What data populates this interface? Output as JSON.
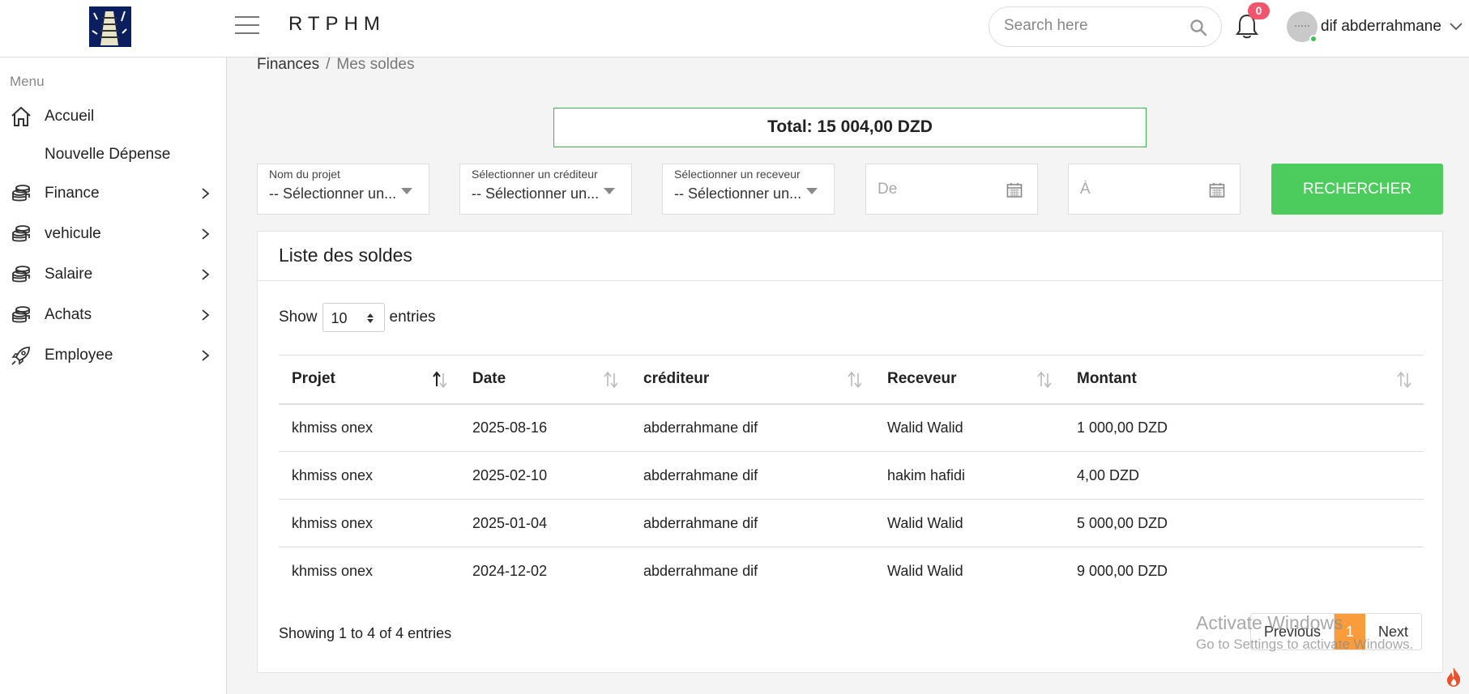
{
  "header": {
    "brand": "RTPHM",
    "search_placeholder": "Search here",
    "notification_count": "0",
    "user_name": "dif abderrahmane"
  },
  "sidebar": {
    "heading": "Menu",
    "items": [
      {
        "label": "Accueil",
        "icon": "home-icon"
      },
      {
        "label": "Nouvelle Dépense",
        "icon": ""
      },
      {
        "label": "Finance",
        "icon": "coins-icon"
      },
      {
        "label": "vehicule",
        "icon": "coins-icon"
      },
      {
        "label": "Salaire",
        "icon": "coins-icon"
      },
      {
        "label": "Achats",
        "icon": "coins-icon"
      },
      {
        "label": "Employee",
        "icon": "rocket-icon"
      }
    ]
  },
  "breadcrumb": {
    "parent": "Finances",
    "separator": "/",
    "current": "Mes soldes"
  },
  "total": "Total: 15 004,00 DZD",
  "filters": {
    "project": {
      "label": "Nom du projet",
      "value": "-- Sélectionner un..."
    },
    "creditor": {
      "label": "Sélectionner un créditeur",
      "value": "-- Sélectionner un..."
    },
    "receiver": {
      "label": "Sélectionner un receveur",
      "value": "-- Sélectionner un..."
    },
    "from_placeholder": "De",
    "to_placeholder": "À",
    "search_button": "RECHERCHER"
  },
  "list": {
    "title": "Liste des soldes",
    "show_label": "Show",
    "entries_label": "entries",
    "page_size": "10",
    "columns": [
      "Projet",
      "Date",
      "créditeur",
      "Receveur",
      "Montant"
    ],
    "rows": [
      [
        "khmiss onex",
        "2025-08-16",
        "abderrahmane dif",
        "Walid Walid",
        "1 000,00 DZD"
      ],
      [
        "khmiss onex",
        "2025-02-10",
        "abderrahmane dif",
        "hakim hafidi",
        "4,00 DZD"
      ],
      [
        "khmiss onex",
        "2025-01-04",
        "abderrahmane dif",
        "Walid Walid",
        "5 000,00 DZD"
      ],
      [
        "khmiss onex",
        "2024-12-02",
        "abderrahmane dif",
        "Walid Walid",
        "9 000,00 DZD"
      ]
    ],
    "info": "Showing 1 to 4 of 4 entries",
    "pagination": {
      "previous": "Previous",
      "current": "1",
      "next": "Next"
    }
  },
  "watermark": {
    "line1": "Activate Windows",
    "line2": "Go to Settings to activate Windows."
  },
  "colors": {
    "accent_green": "#4ccc5d",
    "badge_red": "#f0556c",
    "page_active": "#fa9b3c"
  }
}
